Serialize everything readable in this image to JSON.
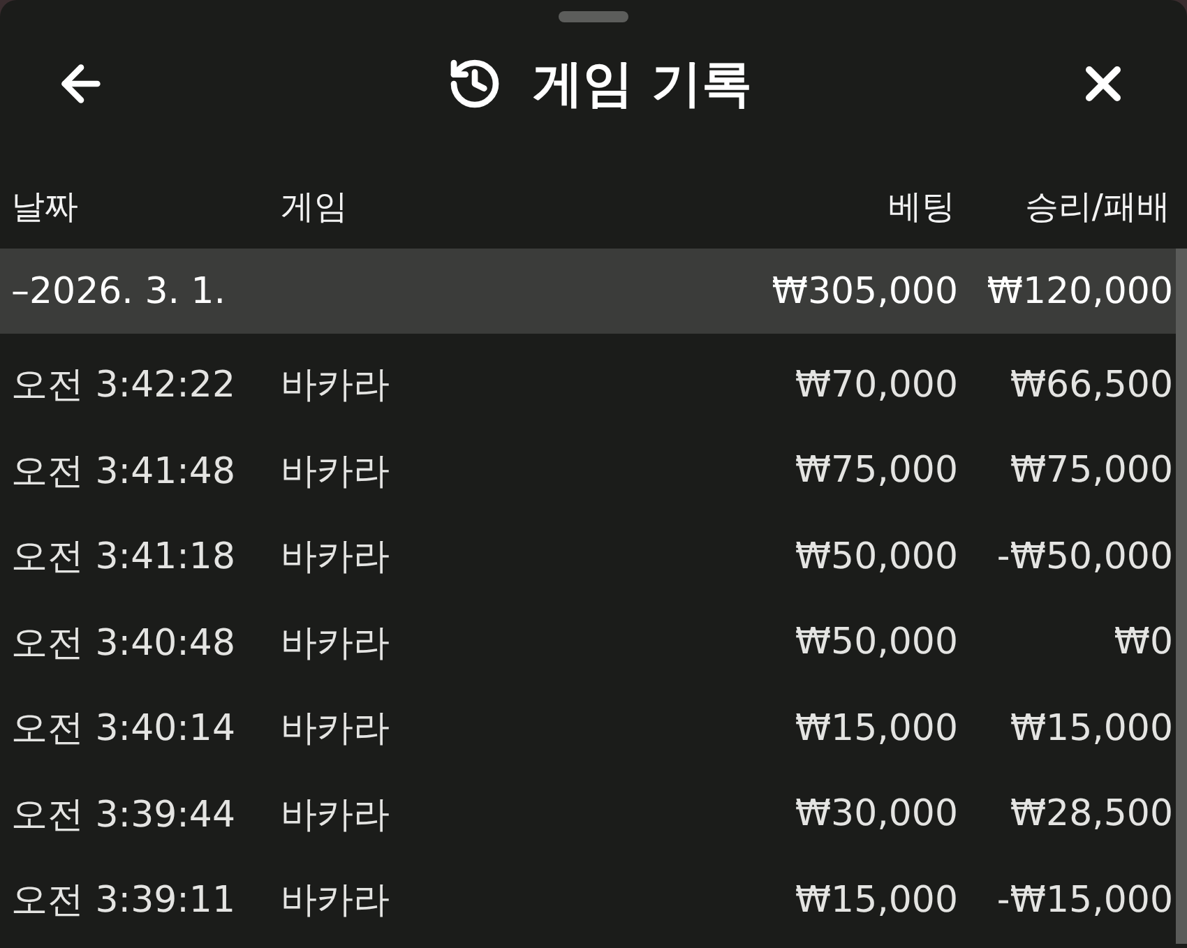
{
  "window": {
    "title": "게임 기록"
  },
  "table": {
    "columns": [
      "날짜",
      "게임",
      "베팅",
      "승리/패배"
    ],
    "groups": [
      {
        "date": "–2026. 3. 1.",
        "bet_total": "₩305,000",
        "result_total": "₩120,000",
        "rows": [
          {
            "time": "오전 3:42:22",
            "game": "바카라",
            "bet": "₩70,000",
            "result": "₩66,500"
          },
          {
            "time": "오전 3:41:48",
            "game": "바카라",
            "bet": "₩75,000",
            "result": "₩75,000"
          },
          {
            "time": "오전 3:41:18",
            "game": "바카라",
            "bet": "₩50,000",
            "result": "-₩50,000"
          },
          {
            "time": "오전 3:40:48",
            "game": "바카라",
            "bet": "₩50,000",
            "result": "₩0"
          },
          {
            "time": "오전 3:40:14",
            "game": "바카라",
            "bet": "₩15,000",
            "result": "₩15,000"
          },
          {
            "time": "오전 3:39:44",
            "game": "바카라",
            "bet": "₩30,000",
            "result": "₩28,500"
          },
          {
            "time": "오전 3:39:11",
            "game": "바카라",
            "bet": "₩15,000",
            "result": "-₩15,000"
          }
        ]
      }
    ]
  }
}
